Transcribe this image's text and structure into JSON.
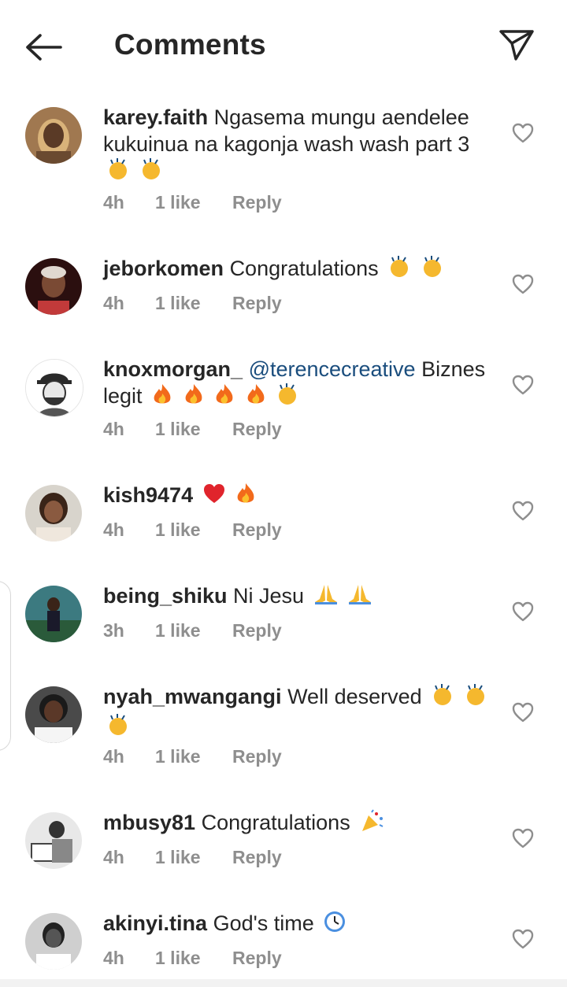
{
  "header": {
    "title": "Comments",
    "back_icon": "arrow-left-icon",
    "send_icon": "paper-plane-icon"
  },
  "colors": {
    "text": "#262626",
    "meta": "#8e8e8e",
    "mention": "#1a4d7d"
  },
  "comments": [
    {
      "username": "karey.faith",
      "text": "Ngasema mungu aendelee kukuinua na kagonja wash wash part 3",
      "emojis": [
        "clap",
        "clap"
      ],
      "time": "4h",
      "likes": "1 like",
      "reply": "Reply"
    },
    {
      "username": "jeborkomen",
      "text": "Congratulations",
      "emojis": [
        "clap",
        "clap"
      ],
      "time": "4h",
      "likes": "1 like",
      "reply": "Reply"
    },
    {
      "username": "knoxmorgan_",
      "mention": "@terencecreative",
      "text": "Biznes legit",
      "emojis": [
        "fire",
        "fire",
        "fire",
        "fire",
        "clap"
      ],
      "time": "4h",
      "likes": "1 like",
      "reply": "Reply"
    },
    {
      "username": "kish9474",
      "text": "",
      "emojis": [
        "heart",
        "fire"
      ],
      "time": "4h",
      "likes": "1 like",
      "reply": "Reply"
    },
    {
      "username": "being_shiku",
      "text": "Ni Jesu",
      "emojis": [
        "pray",
        "pray"
      ],
      "time": "3h",
      "likes": "1 like",
      "reply": "Reply"
    },
    {
      "username": "nyah_mwangangi",
      "text": "Well deserved",
      "emojis": [
        "clap",
        "clap",
        "clap"
      ],
      "time": "4h",
      "likes": "1 like",
      "reply": "Reply"
    },
    {
      "username": "mbusy81",
      "text": "Congratulations",
      "emojis": [
        "party"
      ],
      "time": "4h",
      "likes": "1 like",
      "reply": "Reply"
    },
    {
      "username": "akinyi.tina",
      "text": "God's time",
      "emojis": [
        "clock"
      ],
      "time": "4h",
      "likes": "1 like",
      "reply": "Reply"
    }
  ]
}
